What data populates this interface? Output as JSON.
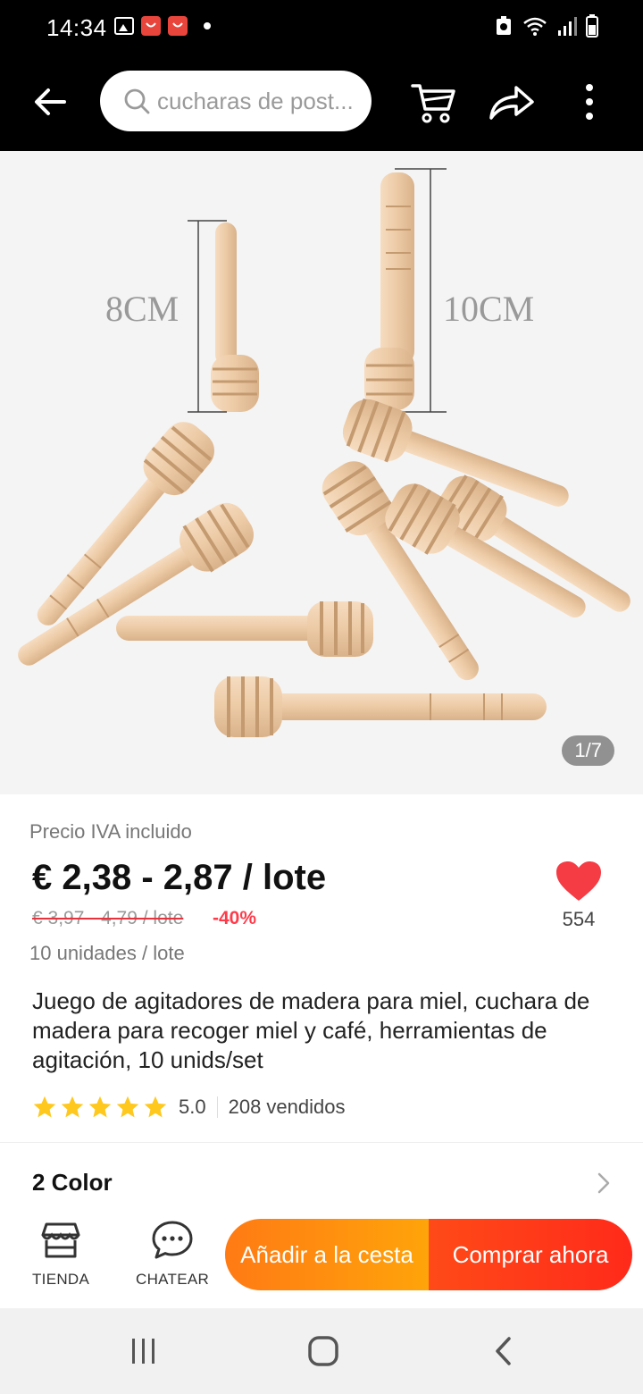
{
  "status_bar": {
    "time": "14:34"
  },
  "header": {
    "search_placeholder": "cucharas de post...",
    "icons": [
      "back-arrow-icon",
      "search-icon",
      "cart-icon",
      "share-icon",
      "more-vertical-icon"
    ]
  },
  "gallery": {
    "counter": "1/7",
    "label_short": "8CM",
    "label_long": "10CM"
  },
  "product": {
    "price_note": "Precio IVA incluido",
    "price": "€ 2,38 - 2,87 / lote",
    "old_price": "€ 3,97 - 4,79 / lote",
    "discount": "-40%",
    "units": "10 unidades / lote",
    "wishlist_count": "554",
    "title": "Juego de agitadores de madera para miel, cuchara de madera para recoger miel y café, herramientas de agitación, 10 unids/set",
    "rating": "5.0",
    "sold": "208 vendidos",
    "stars": 5,
    "option_label": "2 Color"
  },
  "actions": {
    "store": "TIENDA",
    "chat": "CHATEAR",
    "add_to_cart": "Añadir a la cesta",
    "buy_now": "Comprar ahora"
  },
  "colors": {
    "star": "#ffc81e",
    "heart": "#f53b44",
    "discount": "#ff3b4a",
    "cart_button": "#ff8c10",
    "buy_button": "#ff3a19"
  }
}
